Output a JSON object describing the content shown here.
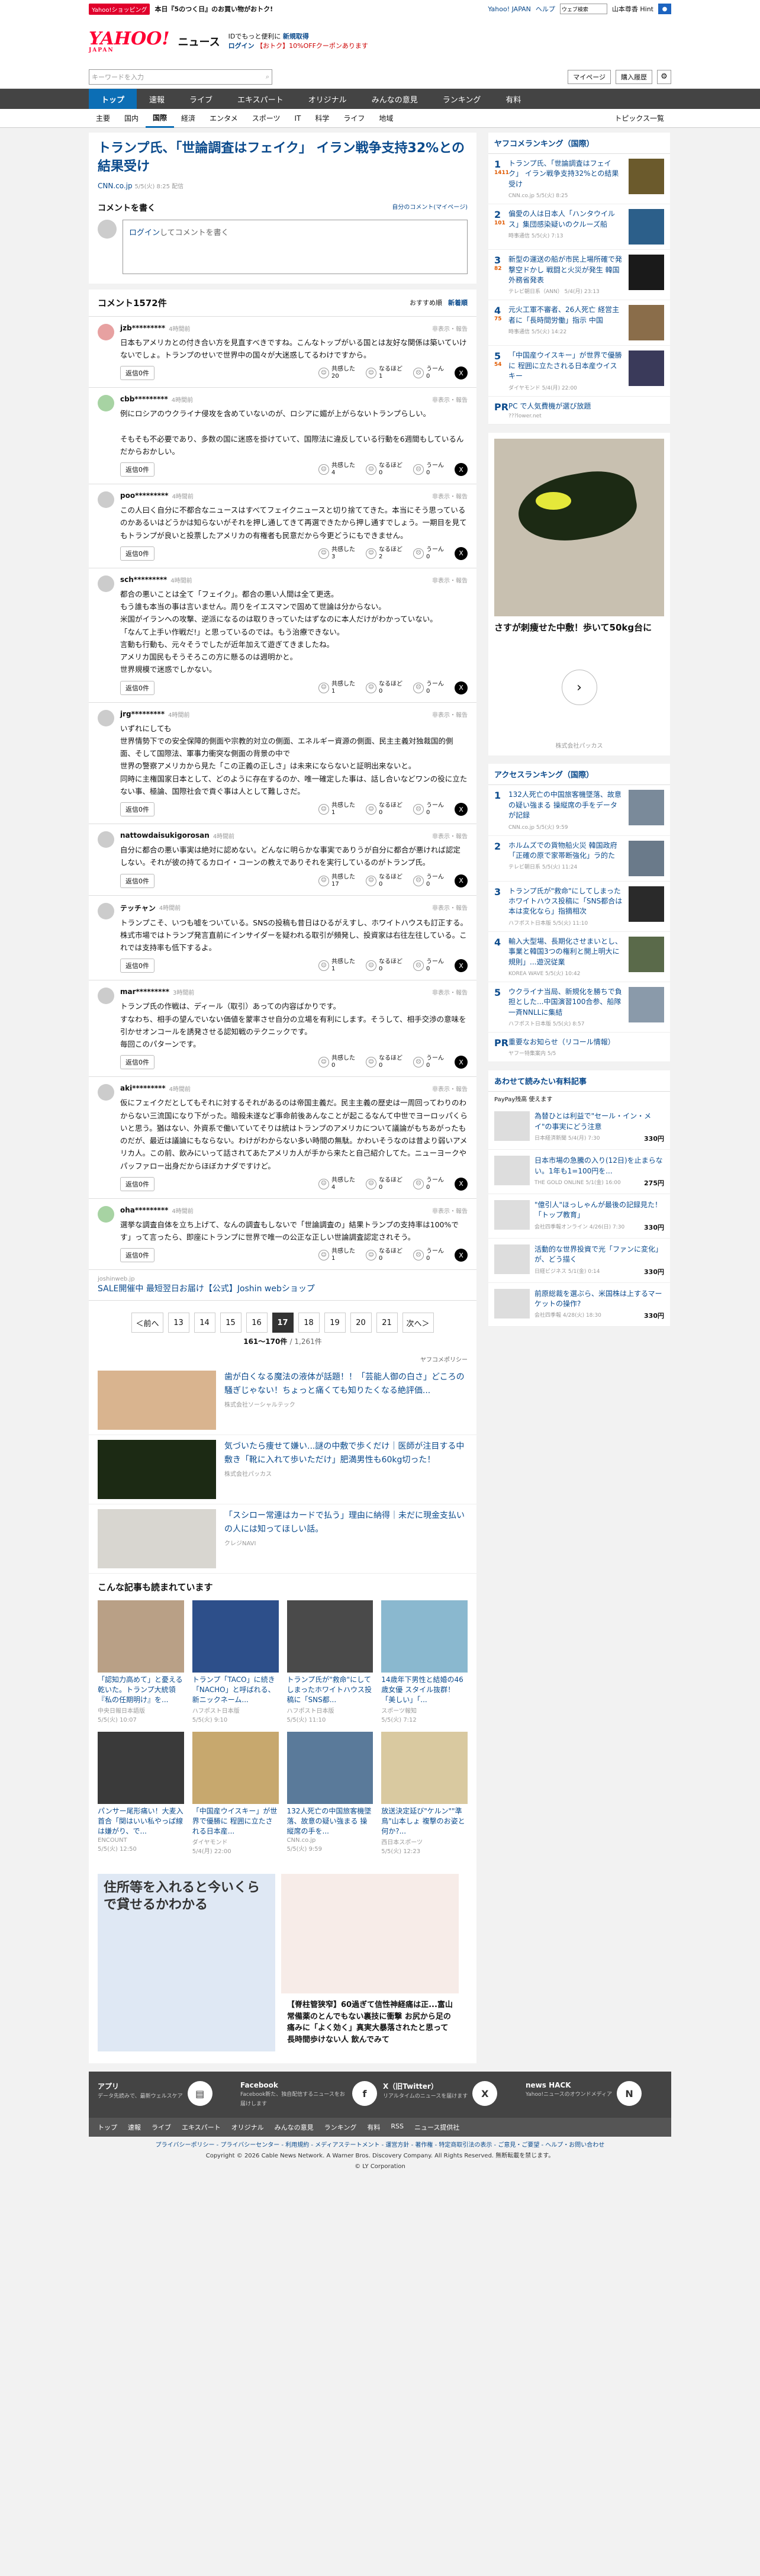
{
  "top": {
    "badge": "Yahoo!ショッピング",
    "promo": "本日『5のつく日』のお買い物がおトク!",
    "yj": "Yahoo! JAPAN",
    "help": "ヘルプ",
    "search_ph": "ウェブ検索",
    "user": "山本尊香 Hint"
  },
  "header": {
    "logo": "YAHOO!",
    "logo_sub": "JAPAN",
    "news": "ニュース",
    "promo1": "IDでもっと便利に",
    "promo1b": "新規取得",
    "promo2": "ログイン",
    "promo2c": "【おトク】10%OFFクーポンあります"
  },
  "search": {
    "ph": "キーワードを入力",
    "mypage": "マイページ",
    "purchase": "購入履歴"
  },
  "gnav": [
    "トップ",
    "速報",
    "ライブ",
    "エキスパート",
    "オリジナル",
    "みんなの意見",
    "ランキング",
    "有料"
  ],
  "snav": [
    "主要",
    "国内",
    "国際",
    "経済",
    "エンタメ",
    "スポーツ",
    "IT",
    "科学",
    "ライフ",
    "地域"
  ],
  "snav_right": "トピックス一覧",
  "article": {
    "title": "トランプ氏、「世論調査はフェイク」 イラン戦争支持32%との結果受け",
    "source": "CNN.co.jp",
    "time": "5/5(火) 8:25 配信"
  },
  "cform": {
    "title": "コメントを書く",
    "mine": "自分のコメント(マイページ)",
    "login": "ログイン",
    "ph": "してコメントを書く"
  },
  "comments_head": {
    "title": "コメント1572件",
    "sort1": "おすすめ順",
    "sort2": "新着順"
  },
  "vote_labels": {
    "empathy": "共感した",
    "insight": "なるほど",
    "hmm": "うーん",
    "reply": "返信0件",
    "report": "非表示・報告"
  },
  "comments": [
    {
      "user": "jzb*********",
      "time": "4時間前",
      "text": "日本もアメリカとの付き合い方を見直すべきですね。こんなトップがいる国とは友好な関係は築いていけないでしょ。トランプのせいで世界中の国々が大迷惑してるわけですから。",
      "e": "20",
      "i": "1",
      "h": "0"
    },
    {
      "user": "cbb*********",
      "time": "4時間前",
      "text": "例にロシアのウクライナ侵攻を含めていないのが、ロシアに媚が上がらないトランプらしい。\n\nそもそも不必要であり、多数の国に迷惑を掛けていて、国際法に違反している行動を6週間もしているんだからおかしい。",
      "e": "4",
      "i": "0",
      "h": "0"
    },
    {
      "user": "poo*********",
      "time": "4時間前",
      "text": "この人曰く自分に不都合なニュースはすべてフェイクニュースと切り捨ててきた。本当にそう思っているのかあるいはどうかは知らないがそれを押し通してきて再選できたから押し通すでしょう。一期目を見てもトランプが良いと投票したアメリカの有権者も民意だから今更どうにもできません。",
      "e": "3",
      "i": "2",
      "h": "0"
    },
    {
      "user": "sch*********",
      "time": "4時間前",
      "text": "都合の悪いことは全て「フェイク」。都合の悪い人間は全て更迭。\nもう誰も本当の事は言いません。周りをイエスマンで固めて世論は分からない。\n米国がイランへの攻撃、逆派になるのは取りきっていたはずなのに本人だけがわかっていない。\n「なんて上手い作戦だ!」と思っているのでは。もう治療できない。\n言動も行動も、元々そうでしたが近年加えて遊ぎてきましたね。\nアメリカ国民もそうそろこの方に懸るのは週明かと。\n世界規模で迷惑でしかない。",
      "e": "1",
      "i": "0",
      "h": "0"
    },
    {
      "user": "jrg*********",
      "time": "4時間前",
      "text": "いずれにしても\n世界情勢下での安全保障的側面や宗教的対立の側面、エネルギー資源の側面、民主主義対独裁国的側面、そして国際法、軍事力衝突な側面の背景の中で\n世界の警察アメリカから見た「この正義の正しさ」は未来にならないと証明出来ないと。\n同時に主権国家日本として、どのように存在するのか、唯一確定した事は、話し合いなどワンの役に立たない事、極論、国際社会で貢ぐ事は人として難しさだ。",
      "e": "1",
      "i": "0",
      "h": "0"
    },
    {
      "user": "nattowdaisukigorosan",
      "time": "4時間前",
      "text": "自分に都合の悪い事実は絶対に認めない。どんなに明らかな事実でありうが自分に都合が悪ければ認定しない。それが彼の持てるカロイ・コーンの教えでありそれを実行しているのがトランプ氏。",
      "e": "17",
      "i": "0",
      "h": "0"
    },
    {
      "user": "テッチャン",
      "time": "4時間前",
      "text": "トランプこそ、いつも嘘をついている。SNSの投稿も昔日はひるがえすし、ホワイトハウスも訂正する。株式市場ではトランプ発言直前にインサイダーを疑われる取引が頻発し、投資家は右往左往している。これでは支持率も低下するよ。",
      "e": "1",
      "i": "0",
      "h": "0"
    },
    {
      "user": "mar*********",
      "time": "3時間前",
      "text": "トランプ氏の作戦は、ディール（取引）あっての内容ばかりです。\nすなわち、相手の望んでいない価値を蒙率させ自分の立場を有利にします。そうして、相手交渉の意味を引かせオンコールを誘発させる認知戦のテクニックです。\n毎回このパターンです。",
      "e": "0",
      "i": "0",
      "h": "0"
    },
    {
      "user": "aki*********",
      "time": "4時間前",
      "text": "仮にフェイクだとしてもそれに対するそれがあるのは帝国主義だ。民主主義の歴史は一周回ってわりのわからない三流国になり下がった。暗殺未遂など事命前後あんなことが起こるなんて中世でヨーロッパくらいと思う。猶はない、外資系で働いていてそりは統はトランプのアメリカについて議論がもちあがったものだが、最近は議論にもならない。わけがわからない多い時間の無駄。かわいそうなのは昔より弱いアメリカ人。この前、飲みにいって話されてあたアメリカ人が手から来たと自己紹介してた。ニューヨークやパッファロー出身だからほぼカナダですけど。",
      "e": "4",
      "i": "0",
      "h": "0"
    },
    {
      "user": "oha*********",
      "time": "4時間前",
      "text": "選挙な調査自体を立ち上げて、なんの調査もしないで「世論調査の」結果トランプの支持率は100%です」って言ったら、即座にトランプに世界で唯一の公正な正しい世論調査認定されそう。",
      "e": "1",
      "i": "0",
      "h": "0"
    }
  ],
  "ad1": {
    "domain": "joshinweb.jp",
    "text": "SALE開催中 最短翌日お届け【公式】Joshin webショップ"
  },
  "pagination": {
    "prev": "＜前へ",
    "pages": [
      "13",
      "14",
      "15",
      "16",
      "17",
      "18",
      "19",
      "20",
      "21"
    ],
    "current": "17",
    "next": "次へ＞",
    "range": "161〜170件",
    "total": "/ 1,261件"
  },
  "yahoo_policy": "ヤフコメポリシー",
  "rec_ads": [
    {
      "title": "歯が白くなる魔法の液体が話題！！「芸能人御の白さ」どころの騒ぎじゃない！ちょっと痛くても知りたくなる絶評価...",
      "sponsor": "株式会社ソーシャルテック"
    },
    {
      "title": "気づいたら痩せて嫌い...謎の中敷で歩くだけ｜医師が注目する中敷き「靴に入れて歩いただけ」肥満男性も60kg切った！",
      "sponsor": "株式会社パッカス"
    },
    {
      "title": "「スシロー常連はカードで払う」理由に納得｜未だに現金支払いの人には知ってほしい話。",
      "sponsor": "クレジNAVI"
    }
  ],
  "also": {
    "title": "こんな記事も読まれています",
    "items": [
      {
        "t": "「認知力高めて」と憂える乾いた。トランプ大統領『私の任期明け』を...",
        "s": "中央日報日本語版",
        "d": "5/5(火) 10:07"
      },
      {
        "t": "トランプ「TACO」に続き「NACHO」と呼ばれる、新ニックネーム...",
        "s": "ハフポスト日本版",
        "d": "5/5(火) 9:10"
      },
      {
        "t": "トランプ氏が\"救命\"にしてしまったホワイトハウス投稿に「SNS都...",
        "s": "ハフポスト日本版",
        "d": "5/5(火) 11:10"
      },
      {
        "t": "14歳年下男性と結婚の46歳女優 スタイル抜群！「美しい」「...",
        "s": "スポーツ報知",
        "d": "5/5(火) 7:12"
      },
      {
        "t": "パンサー尾形痛い！大麦入首合「関はいい私やっぱ線は嫌がり、で...",
        "s": "ENCOUNT",
        "d": "5/5(火) 12:50"
      },
      {
        "t": "「中国産ウイスキー」が世界で優勝に 程囲に立たされる日本産...",
        "s": "ダイヤモンド",
        "d": "5/4(月) 22:00"
      },
      {
        "t": "132人死亡の中国旅客機墜落、故意の疑い強まる 操縦席の手を...",
        "s": "CNN.co.jp",
        "d": "5/5(火) 9:59"
      },
      {
        "t": "放送決定延び\"ケルン\"\"準鳥\"山本しょ 複撃のお姿と何か?...",
        "s": "西日本スポーツ",
        "d": "5/5(火) 12:23"
      }
    ]
  },
  "bigad": {
    "l_text": "住所等を入れると今いくらで貸せるかわかる",
    "r_text": "【脊柱管狭窄】60過ぎて信性神経痛は正...富山常備薬のとんでもない裏技に衝撃 お尻から足の痛みに「よく効く」真実大暴落されたと思って長時間歩けない人 飲んでみて"
  },
  "ranking": {
    "title": "ヤフコメランキング（国際）",
    "items": [
      {
        "t": "トランプ氏、「世論調査はフェイク」 イラン戦争支持32%との結果受け",
        "s": "CNN.co.jp 5/5(火) 8:25",
        "c": "1411"
      },
      {
        "t": "偏愛の人は日本人「ハンタウイルス」集団感染疑いのクルーズ船",
        "s": "時事通信 5/5(火) 7:13",
        "c": "101"
      },
      {
        "t": "新型の運送の船が市民上場所確で発撃空ドかし 戦闘と火災が発生 韓国外務省発表",
        "s": "テレビ朝日系（ANN） 5/4(月) 23:13",
        "c": "82"
      },
      {
        "t": "元火工軍不審者、26人死亡 経営主者に「長時間労働」指示 中国",
        "s": "時事通信 5/5(火) 14:22",
        "c": "75"
      },
      {
        "t": "「中国産ウイスキー」が世界で優勝に 程囲に立たされる日本産ウイスキー",
        "s": "ダイヤモンド 5/4(月) 22:00",
        "c": "54"
      }
    ],
    "pr": "PC で人気費機が選び放題",
    "pr_sp": "???lower.net"
  },
  "side_ad": {
    "title": "さすが刺痩せた中敷！歩いて50kg台に",
    "sponsor": "株式会社パッカス"
  },
  "access": {
    "title": "アクセスランキング（国際）",
    "items": [
      {
        "t": "132人死亡の中国旅客機墜落、故意の疑い強まる 操縦席の手をデータが記録",
        "s": "CNN.co.jp 5/5(火) 9:59"
      },
      {
        "t": "ホルムズでの貨物船火災 韓国政府「正確の原で家帯断強化」ラ的た",
        "s": "テレビ朝日系 5/5(火) 11:24"
      },
      {
        "t": "トランプ氏が\"救命\"にしてしまったホワイトハウス投稿に「SNS都合は本は変化なら」指摘相次",
        "s": "ハフポスト日本版 5/5(火) 11:10"
      },
      {
        "t": "輸入大型場、長期化させまいとし、事業と韓国3つの権利と開上明大に規則」...遊況従業",
        "s": "KOREA WAVE 5/5(火) 10:42"
      },
      {
        "t": "ウクライナ当局、新規化を勝ちで負担とした...中国演習100合参、船隊一斉NNLLに集結",
        "s": "ハフポスト日本版 5/5(火) 8:57"
      }
    ],
    "pr": "重要なお知らせ（リコール情報）",
    "pr_sp": "ヤフー特集案内 5/5"
  },
  "paid": {
    "title": "あわせて読みたい有料記事",
    "sub": "PayPay残高 使えます",
    "items": [
      {
        "t": "為替ひとは利益で\"セール・イン・メイ\"の事実にどう注意",
        "s": "日本経済新聞 5/4(月) 7:30",
        "p": "330円"
      },
      {
        "t": "日本市場の急騰の入り(12日)を止まらない。1年も1=100円を...",
        "s": "THE GOLD ONLINE 5/1(金) 16:00",
        "p": "275円"
      },
      {
        "t": "\"億引人\"ほっしゃんが最後の記録見た！「トップ教育」",
        "s": "会社四季報オンライン 4/26(日) 7:30",
        "p": "330円"
      },
      {
        "t": "活動的な世界投資で光「ファンに変化」が、どう描く",
        "s": "日経ビジネス 5/1(金) 0:14",
        "p": "330円"
      },
      {
        "t": "前原総裁を選ぶら、米国株は上するマーケットの操作?",
        "s": "会社四季報 4/28(火) 18:30",
        "p": "330円"
      }
    ]
  },
  "footer": {
    "items": [
      {
        "name": "アプリ",
        "desc": "データ先読みで、最新ウェルスケア"
      },
      {
        "name": "Facebook",
        "desc": "Facebook新た、独自配信するニュースをお届けします"
      },
      {
        "name": "X（旧Twitter）",
        "desc": "リアルタイムのニュースを届けます"
      },
      {
        "name": "news HACK",
        "desc": "Yahoo!ニュースのオウンドメディア"
      }
    ],
    "nav": [
      "トップ",
      "速報",
      "ライブ",
      "エキスパート",
      "オリジナル",
      "みんなの意見",
      "ランキング",
      "有料",
      "RSS",
      "ニュース提供社"
    ],
    "links": "プライバシーポリシー - プライバシーセンター - 利用規約 - メディアステートメント - 運営方針 - 著作権 - 特定商取引法の表示 - ご意見・ご要望 - ヘルプ・お問い合わせ",
    "copy1": "Copyright © 2026 Cable News Network. A Warner Bros. Discovery Company. All Rights Reserved. 無断転載を禁じます。",
    "copy2": "© LY Corporation"
  }
}
